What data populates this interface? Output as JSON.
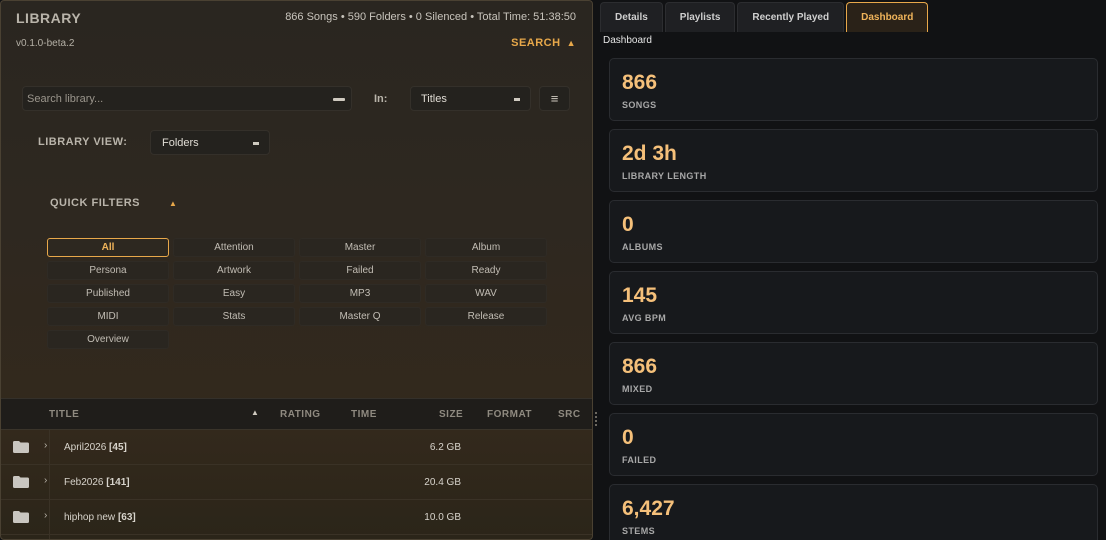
{
  "library": {
    "title": "LIBRARY",
    "stats": "866 Songs • 590 Folders • 0 Silenced • Total Time: 51:38:50",
    "version": "v0.1.0-beta.2",
    "search_toggle": "SEARCH",
    "search_placeholder": "Search library...",
    "in_label": "In:",
    "in_value": "Titles",
    "view_label": "LIBRARY VIEW:",
    "view_value": "Folders",
    "quick_filters_label": "QUICK FILTERS",
    "filters": [
      "All",
      "Attention",
      "Master",
      "Album",
      "Persona",
      "Artwork",
      "Failed",
      "Ready",
      "Published",
      "Easy",
      "MP3",
      "WAV",
      "MIDI",
      "Stats",
      "Master Q",
      "Release",
      "Overview"
    ],
    "active_filter": "All",
    "columns": {
      "title": "TITLE",
      "rating": "RATING",
      "time": "TIME",
      "size": "SIZE",
      "format": "FORMAT",
      "src": "SRC"
    },
    "rows": [
      {
        "name": "April2026",
        "count": "[45]",
        "size": "6.2 GB"
      },
      {
        "name": "Feb2026",
        "count": "[141]",
        "size": "20.4 GB"
      },
      {
        "name": "hiphop new",
        "count": "[63]",
        "size": "10.0 GB"
      }
    ]
  },
  "right": {
    "tabs": [
      "Details",
      "Playlists",
      "Recently Played",
      "Dashboard"
    ],
    "active_tab": "Dashboard",
    "section_label": "Dashboard",
    "cards": [
      {
        "value": "866",
        "label": "SONGS"
      },
      {
        "value": "2d 3h",
        "label": "LIBRARY LENGTH"
      },
      {
        "value": "0",
        "label": "ALBUMS"
      },
      {
        "value": "145",
        "label": "AVG BPM"
      },
      {
        "value": "866",
        "label": "MIXED"
      },
      {
        "value": "0",
        "label": "FAILED"
      },
      {
        "value": "6,427",
        "label": "STEMS"
      }
    ]
  },
  "colors": {
    "accent": "#e8a84a",
    "value": "#f5c07a"
  }
}
